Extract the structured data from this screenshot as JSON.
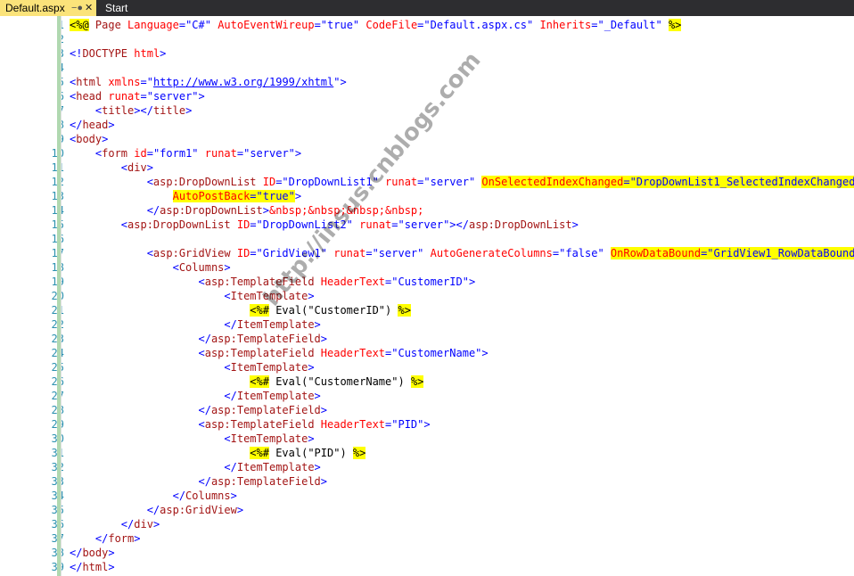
{
  "tabs": [
    {
      "label": "Default.aspx",
      "active": true
    },
    {
      "label": "Start Page",
      "active": false
    }
  ],
  "tab_icons": {
    "pin": "pin-icon",
    "close": "close-icon"
  },
  "editor": {
    "colors": {
      "tag": "#0000ff",
      "element": "#a31515",
      "attribute": "#ff0000",
      "text": "#000000",
      "highlight": "#ffff00",
      "line_number": "#2b91af",
      "active_tab": "#fbe37a",
      "tab_bar": "#2d2d30"
    },
    "lines": [
      {
        "n": "1",
        "segments": [
          {
            "t": "<%@",
            "c": "black",
            "hl": true
          },
          {
            "t": " Page ",
            "c": "maroon"
          },
          {
            "t": "Language",
            "c": "red"
          },
          {
            "t": "=\"C#\" ",
            "c": "blue"
          },
          {
            "t": "AutoEventWireup",
            "c": "red"
          },
          {
            "t": "=\"true\" ",
            "c": "blue"
          },
          {
            "t": "CodeFile",
            "c": "red"
          },
          {
            "t": "=\"Default.aspx.cs\" ",
            "c": "blue"
          },
          {
            "t": "Inherits",
            "c": "red"
          },
          {
            "t": "=\"_Default\" ",
            "c": "blue"
          },
          {
            "t": "%>",
            "c": "black",
            "hl": true
          }
        ]
      },
      {
        "n": "2",
        "segments": []
      },
      {
        "n": "3",
        "segments": [
          {
            "t": "<!",
            "c": "blue"
          },
          {
            "t": "DOCTYPE",
            "c": "maroon"
          },
          {
            "t": " ",
            "c": "blue"
          },
          {
            "t": "html",
            "c": "red"
          },
          {
            "t": ">",
            "c": "blue"
          }
        ]
      },
      {
        "n": "4",
        "segments": []
      },
      {
        "n": "5",
        "segments": [
          {
            "t": "<",
            "c": "blue"
          },
          {
            "t": "html",
            "c": "maroon"
          },
          {
            "t": " ",
            "c": "blue"
          },
          {
            "t": "xmlns",
            "c": "red"
          },
          {
            "t": "=\"",
            "c": "blue"
          },
          {
            "t": "http://www.w3.org/1999/xhtml",
            "c": "link"
          },
          {
            "t": "\">",
            "c": "blue"
          }
        ]
      },
      {
        "n": "6",
        "segments": [
          {
            "t": "<",
            "c": "blue"
          },
          {
            "t": "head",
            "c": "maroon"
          },
          {
            "t": " ",
            "c": "blue"
          },
          {
            "t": "runat",
            "c": "red"
          },
          {
            "t": "=\"server\">",
            "c": "blue"
          }
        ]
      },
      {
        "n": "7",
        "segments": [
          {
            "t": "    <",
            "c": "blue"
          },
          {
            "t": "title",
            "c": "maroon"
          },
          {
            "t": "></",
            "c": "blue"
          },
          {
            "t": "title",
            "c": "maroon"
          },
          {
            "t": ">",
            "c": "blue"
          }
        ]
      },
      {
        "n": "8",
        "segments": [
          {
            "t": "</",
            "c": "blue"
          },
          {
            "t": "head",
            "c": "maroon"
          },
          {
            "t": ">",
            "c": "blue"
          }
        ]
      },
      {
        "n": "9",
        "segments": [
          {
            "t": "<",
            "c": "blue"
          },
          {
            "t": "body",
            "c": "maroon"
          },
          {
            "t": ">",
            "c": "blue"
          }
        ]
      },
      {
        "n": "10",
        "segments": [
          {
            "t": "    <",
            "c": "blue"
          },
          {
            "t": "form",
            "c": "maroon"
          },
          {
            "t": " ",
            "c": "blue"
          },
          {
            "t": "id",
            "c": "red"
          },
          {
            "t": "=\"form1\" ",
            "c": "blue"
          },
          {
            "t": "runat",
            "c": "red"
          },
          {
            "t": "=\"server\">",
            "c": "blue"
          }
        ]
      },
      {
        "n": "11",
        "segments": [
          {
            "t": "        <",
            "c": "blue"
          },
          {
            "t": "div",
            "c": "maroon"
          },
          {
            "t": ">",
            "c": "blue"
          }
        ]
      },
      {
        "n": "12",
        "segments": [
          {
            "t": "            <",
            "c": "blue"
          },
          {
            "t": "asp:DropDownList",
            "c": "maroon"
          },
          {
            "t": " ",
            "c": "blue"
          },
          {
            "t": "ID",
            "c": "red"
          },
          {
            "t": "=\"DropDownList1\" ",
            "c": "blue"
          },
          {
            "t": "runat",
            "c": "red"
          },
          {
            "t": "=\"server\" ",
            "c": "blue"
          },
          {
            "t": "OnSelectedIndexChanged",
            "c": "red",
            "hl": true
          },
          {
            "t": "=\"DropDownList1_SelectedIndexChanged\"",
            "c": "blue",
            "hl": true
          }
        ]
      },
      {
        "n": "13",
        "segments": [
          {
            "t": "                ",
            "c": "blue"
          },
          {
            "t": "AutoPostBack",
            "c": "red",
            "hl": true
          },
          {
            "t": "=\"true\"",
            "c": "blue",
            "hl": true
          },
          {
            "t": ">",
            "c": "blue"
          }
        ]
      },
      {
        "n": "14",
        "segments": [
          {
            "t": "            </",
            "c": "blue"
          },
          {
            "t": "asp:DropDownList",
            "c": "maroon"
          },
          {
            "t": ">",
            "c": "blue"
          },
          {
            "t": "&nbsp;&nbsp;&nbsp;&nbsp;",
            "c": "red"
          }
        ]
      },
      {
        "n": "15",
        "segments": [
          {
            "t": "        <",
            "c": "blue"
          },
          {
            "t": "asp:DropDownList",
            "c": "maroon"
          },
          {
            "t": " ",
            "c": "blue"
          },
          {
            "t": "ID",
            "c": "red"
          },
          {
            "t": "=\"DropDownList2\" ",
            "c": "blue"
          },
          {
            "t": "runat",
            "c": "red"
          },
          {
            "t": "=\"server\"></",
            "c": "blue"
          },
          {
            "t": "asp:DropDownList",
            "c": "maroon"
          },
          {
            "t": ">",
            "c": "blue"
          }
        ]
      },
      {
        "n": "16",
        "segments": []
      },
      {
        "n": "17",
        "segments": [
          {
            "t": "            <",
            "c": "blue"
          },
          {
            "t": "asp:GridView",
            "c": "maroon"
          },
          {
            "t": " ",
            "c": "blue"
          },
          {
            "t": "ID",
            "c": "red"
          },
          {
            "t": "=\"GridView1\" ",
            "c": "blue"
          },
          {
            "t": "runat",
            "c": "red"
          },
          {
            "t": "=\"server\" ",
            "c": "blue"
          },
          {
            "t": "AutoGenerateColumns",
            "c": "red"
          },
          {
            "t": "=\"false\" ",
            "c": "blue"
          },
          {
            "t": "OnRowDataBound",
            "c": "red",
            "hl": true
          },
          {
            "t": "=\"GridView1_RowDataBound\"",
            "c": "blue",
            "hl": true
          },
          {
            "t": ">",
            "c": "blue"
          }
        ]
      },
      {
        "n": "18",
        "segments": [
          {
            "t": "                <",
            "c": "blue"
          },
          {
            "t": "Columns",
            "c": "maroon"
          },
          {
            "t": ">",
            "c": "blue"
          }
        ]
      },
      {
        "n": "19",
        "segments": [
          {
            "t": "                    <",
            "c": "blue"
          },
          {
            "t": "asp:TemplateField",
            "c": "maroon"
          },
          {
            "t": " ",
            "c": "blue"
          },
          {
            "t": "HeaderText",
            "c": "red"
          },
          {
            "t": "=\"CustomerID\">",
            "c": "blue"
          }
        ]
      },
      {
        "n": "20",
        "segments": [
          {
            "t": "                        <",
            "c": "blue"
          },
          {
            "t": "ItemTemplate",
            "c": "maroon"
          },
          {
            "t": ">",
            "c": "blue"
          }
        ]
      },
      {
        "n": "21",
        "segments": [
          {
            "t": "                            ",
            "c": "black"
          },
          {
            "t": "<%#",
            "c": "black",
            "hl": true
          },
          {
            "t": " Eval(\"CustomerID\") ",
            "c": "black"
          },
          {
            "t": "%>",
            "c": "black",
            "hl": true
          }
        ]
      },
      {
        "n": "22",
        "segments": [
          {
            "t": "                        </",
            "c": "blue"
          },
          {
            "t": "ItemTemplate",
            "c": "maroon"
          },
          {
            "t": ">",
            "c": "blue"
          }
        ]
      },
      {
        "n": "23",
        "segments": [
          {
            "t": "                    </",
            "c": "blue"
          },
          {
            "t": "asp:TemplateField",
            "c": "maroon"
          },
          {
            "t": ">",
            "c": "blue"
          }
        ]
      },
      {
        "n": "24",
        "segments": [
          {
            "t": "                    <",
            "c": "blue"
          },
          {
            "t": "asp:TemplateField",
            "c": "maroon"
          },
          {
            "t": " ",
            "c": "blue"
          },
          {
            "t": "HeaderText",
            "c": "red"
          },
          {
            "t": "=\"CustomerName\">",
            "c": "blue"
          }
        ]
      },
      {
        "n": "25",
        "segments": [
          {
            "t": "                        <",
            "c": "blue"
          },
          {
            "t": "ItemTemplate",
            "c": "maroon"
          },
          {
            "t": ">",
            "c": "blue"
          }
        ]
      },
      {
        "n": "26",
        "segments": [
          {
            "t": "                            ",
            "c": "black"
          },
          {
            "t": "<%#",
            "c": "black",
            "hl": true
          },
          {
            "t": " Eval(\"CustomerName\") ",
            "c": "black"
          },
          {
            "t": "%>",
            "c": "black",
            "hl": true
          }
        ]
      },
      {
        "n": "27",
        "segments": [
          {
            "t": "                        </",
            "c": "blue"
          },
          {
            "t": "ItemTemplate",
            "c": "maroon"
          },
          {
            "t": ">",
            "c": "blue"
          }
        ]
      },
      {
        "n": "28",
        "segments": [
          {
            "t": "                    </",
            "c": "blue"
          },
          {
            "t": "asp:TemplateField",
            "c": "maroon"
          },
          {
            "t": ">",
            "c": "blue"
          }
        ]
      },
      {
        "n": "29",
        "segments": [
          {
            "t": "                    <",
            "c": "blue"
          },
          {
            "t": "asp:TemplateField",
            "c": "maroon"
          },
          {
            "t": " ",
            "c": "blue"
          },
          {
            "t": "HeaderText",
            "c": "red"
          },
          {
            "t": "=\"PID\">",
            "c": "blue"
          }
        ]
      },
      {
        "n": "30",
        "segments": [
          {
            "t": "                        <",
            "c": "blue"
          },
          {
            "t": "ItemTemplate",
            "c": "maroon"
          },
          {
            "t": ">",
            "c": "blue"
          }
        ]
      },
      {
        "n": "31",
        "segments": [
          {
            "t": "                            ",
            "c": "black"
          },
          {
            "t": "<%#",
            "c": "black",
            "hl": true
          },
          {
            "t": " Eval(\"PID\") ",
            "c": "black"
          },
          {
            "t": "%>",
            "c": "black",
            "hl": true
          }
        ]
      },
      {
        "n": "32",
        "segments": [
          {
            "t": "                        </",
            "c": "blue"
          },
          {
            "t": "ItemTemplate",
            "c": "maroon"
          },
          {
            "t": ">",
            "c": "blue"
          }
        ]
      },
      {
        "n": "33",
        "segments": [
          {
            "t": "                    </",
            "c": "blue"
          },
          {
            "t": "asp:TemplateField",
            "c": "maroon"
          },
          {
            "t": ">",
            "c": "blue"
          }
        ]
      },
      {
        "n": "34",
        "segments": [
          {
            "t": "                </",
            "c": "blue"
          },
          {
            "t": "Columns",
            "c": "maroon"
          },
          {
            "t": ">",
            "c": "blue"
          }
        ]
      },
      {
        "n": "35",
        "segments": [
          {
            "t": "            </",
            "c": "blue"
          },
          {
            "t": "asp:GridView",
            "c": "maroon"
          },
          {
            "t": ">",
            "c": "blue"
          }
        ]
      },
      {
        "n": "36",
        "segments": [
          {
            "t": "        </",
            "c": "blue"
          },
          {
            "t": "div",
            "c": "maroon"
          },
          {
            "t": ">",
            "c": "blue"
          }
        ]
      },
      {
        "n": "37",
        "segments": [
          {
            "t": "    </",
            "c": "blue"
          },
          {
            "t": "form",
            "c": "maroon"
          },
          {
            "t": ">",
            "c": "blue"
          }
        ]
      },
      {
        "n": "38",
        "segments": [
          {
            "t": "</",
            "c": "blue"
          },
          {
            "t": "body",
            "c": "maroon"
          },
          {
            "t": ">",
            "c": "blue"
          }
        ]
      },
      {
        "n": "39",
        "segments": [
          {
            "t": "</",
            "c": "blue"
          },
          {
            "t": "html",
            "c": "maroon"
          },
          {
            "t": ">",
            "c": "blue"
          }
        ]
      }
    ]
  },
  "watermark": {
    "text": "http://insus.cnblogs.com"
  }
}
